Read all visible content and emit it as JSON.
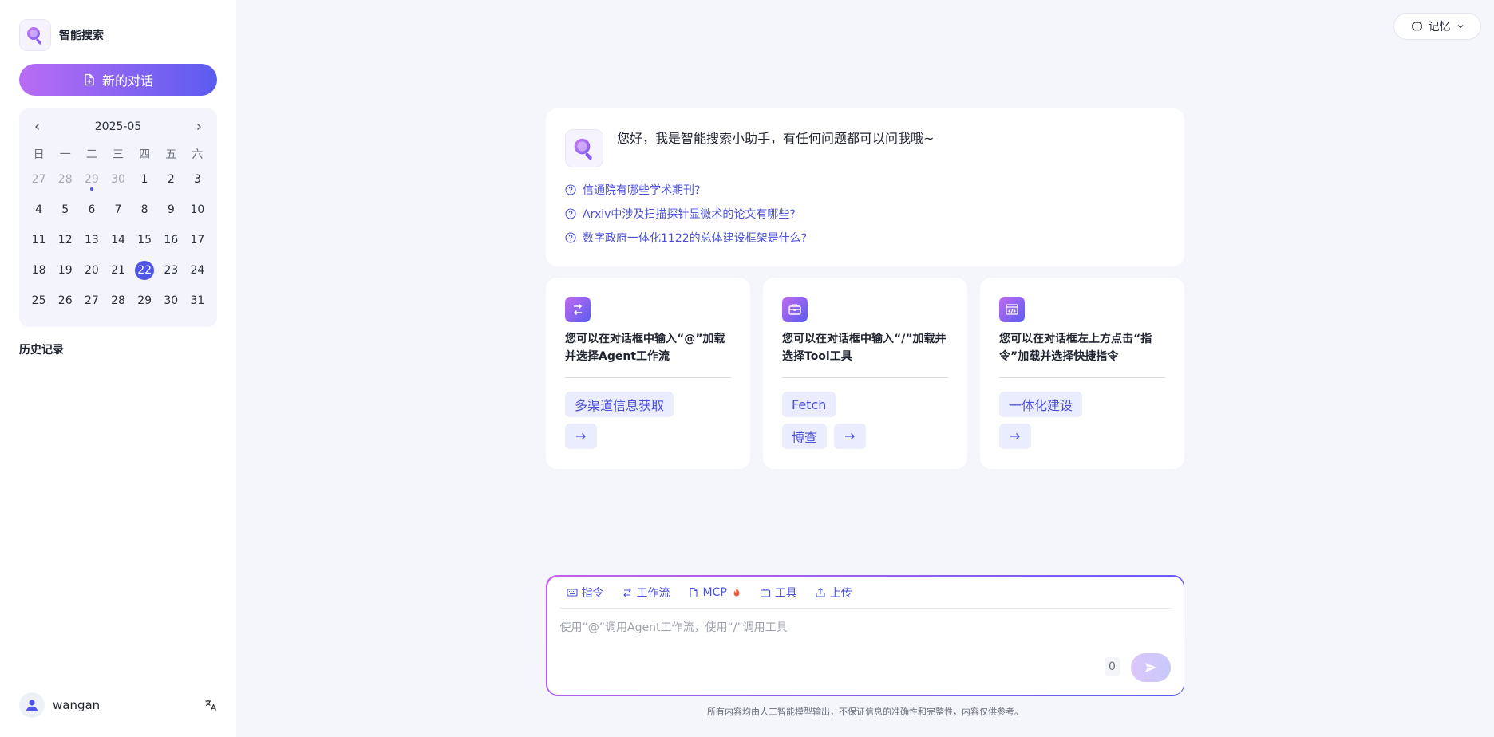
{
  "app": {
    "name": "智能搜索"
  },
  "sidebar": {
    "new_chat_label": "新的对话",
    "history_title": "历史记录",
    "user_name": "wangan"
  },
  "calendar": {
    "title": "2025-05",
    "weekdays": [
      "日",
      "一",
      "二",
      "三",
      "四",
      "五",
      "六"
    ],
    "days": [
      {
        "d": "27",
        "muted": true
      },
      {
        "d": "28",
        "muted": true
      },
      {
        "d": "29",
        "muted": true,
        "dot": true
      },
      {
        "d": "30",
        "muted": true
      },
      {
        "d": "1"
      },
      {
        "d": "2"
      },
      {
        "d": "3"
      },
      {
        "d": "4"
      },
      {
        "d": "5"
      },
      {
        "d": "6"
      },
      {
        "d": "7"
      },
      {
        "d": "8"
      },
      {
        "d": "9"
      },
      {
        "d": "10"
      },
      {
        "d": "11"
      },
      {
        "d": "12"
      },
      {
        "d": "13"
      },
      {
        "d": "14"
      },
      {
        "d": "15"
      },
      {
        "d": "16"
      },
      {
        "d": "17"
      },
      {
        "d": "18"
      },
      {
        "d": "19"
      },
      {
        "d": "20"
      },
      {
        "d": "21"
      },
      {
        "d": "22",
        "today": true
      },
      {
        "d": "23"
      },
      {
        "d": "24"
      },
      {
        "d": "25"
      },
      {
        "d": "26"
      },
      {
        "d": "27"
      },
      {
        "d": "28"
      },
      {
        "d": "29"
      },
      {
        "d": "30"
      },
      {
        "d": "31"
      }
    ]
  },
  "header": {
    "memory_label": "记忆"
  },
  "welcome": {
    "greeting": "您好，我是智能搜索小助手，有任何问题都可以问我哦~",
    "suggestions": [
      "信通院有哪些学术期刊?",
      "Arxiv中涉及扫描探针显微术的论文有哪些?",
      "数字政府一体化1122的总体建设框架是什么?"
    ]
  },
  "cards": [
    {
      "icon": "workflow-icon",
      "text": "您可以在对话框中输入“@”加载并选择Agent工作流",
      "chips": [
        "多渠道信息获取"
      ]
    },
    {
      "icon": "toolbox-icon",
      "text": "您可以在对话框中输入“/”加载并选择Tool工具",
      "chips": [
        "Fetch",
        "博查"
      ]
    },
    {
      "icon": "code-window-icon",
      "text": "您可以在对话框左上方点击“指令”加载并选择快捷指令",
      "chips": [
        "一体化建设"
      ]
    }
  ],
  "composer": {
    "toolbar": {
      "command": "指令",
      "workflow": "工作流",
      "mcp": "MCP",
      "tool": "工具",
      "upload": "上传"
    },
    "placeholder": "使用“@”调用Agent工作流，使用“/”调用工具",
    "count": "0"
  },
  "footer": {
    "note": "所有内容均由人工智能模型输出，不保证信息的准确性和完整性，内容仅供参考。"
  },
  "colors": {
    "accent": "#4f55e6",
    "gradient_start": "#b96cf4",
    "gradient_end": "#5b5cf0"
  }
}
